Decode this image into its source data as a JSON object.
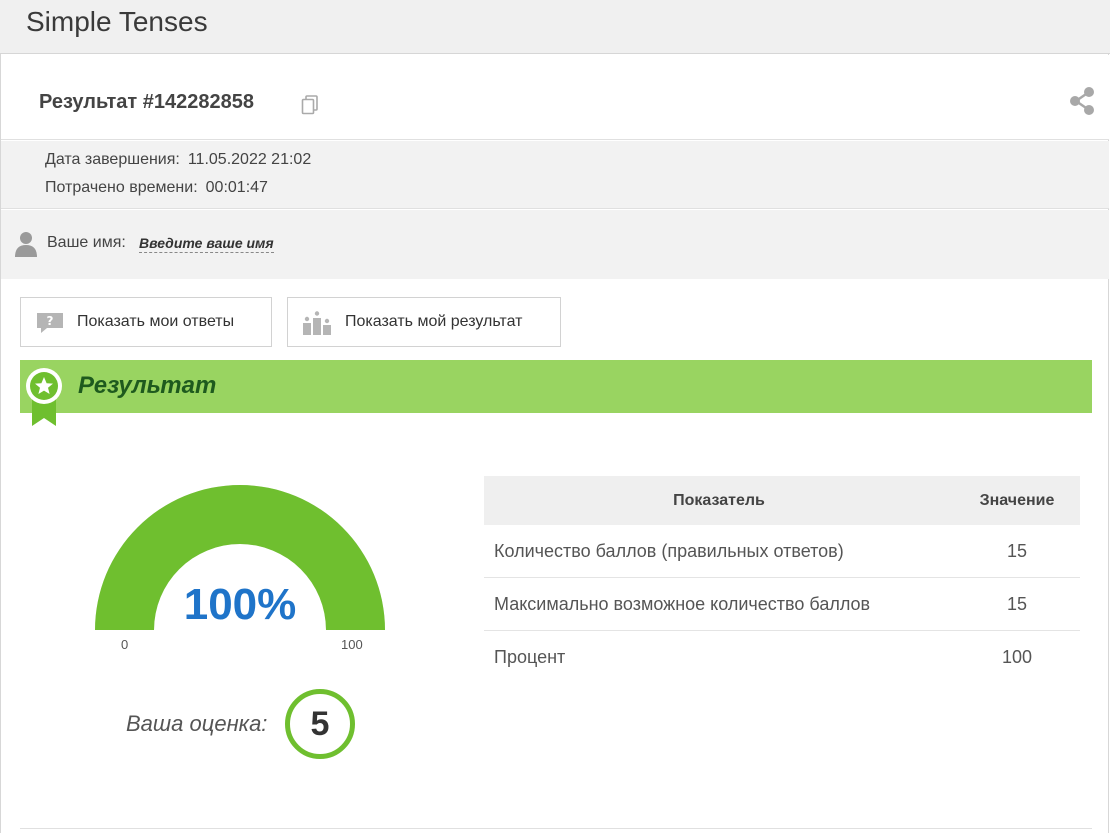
{
  "app": {
    "title": "Simple Tenses"
  },
  "result": {
    "title": "Результат #142282858"
  },
  "meta": {
    "finish_label": "Дата завершения:",
    "finish_value": "11.05.2022 21:02",
    "time_label": "Потрачено времени:",
    "time_value": "00:01:47"
  },
  "user": {
    "name_label": "Ваше имя:",
    "name_placeholder": "Введите ваше имя"
  },
  "buttons": {
    "show_answers": "Показать мои ответы",
    "show_result": "Показать мой результат"
  },
  "section": {
    "title": "Результат"
  },
  "gauge": {
    "value_text": "100%",
    "percent": 100,
    "min": "0",
    "max": "100"
  },
  "grade": {
    "label": "Ваша оценка:",
    "value": "5"
  },
  "table": {
    "headers": [
      "Показатель",
      "Значение"
    ],
    "rows": [
      {
        "name": "Количество баллов (правильных ответов)",
        "value": "15"
      },
      {
        "name": "Максимально возможное количество баллов",
        "value": "15"
      },
      {
        "name": "Процент",
        "value": "100"
      }
    ]
  },
  "icons": {
    "copy": "copy-icon",
    "share": "share-icon",
    "person": "person-icon",
    "answers": "speech-bubble-question-icon",
    "result": "podium-icon",
    "ribbon": "award-ribbon-icon"
  },
  "colors": {
    "section_green": "#99d461",
    "gauge_green": "#6fbf2f",
    "percent_blue": "#1f74c9",
    "section_title": "#1e5a1e"
  }
}
